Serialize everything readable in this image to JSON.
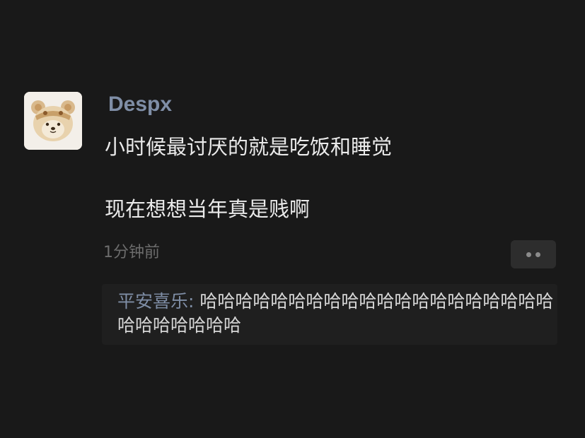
{
  "post": {
    "username": "Despx",
    "content_line1": "小时候最讨厌的就是吃饭和睡觉",
    "content_line2": "现在想想当年真是贱啊",
    "timestamp": "1分钟前",
    "avatar_icon": "bear-avatar-icon",
    "more_icon": "more-dots-icon"
  },
  "comment": {
    "author": "平安喜乐:",
    "text": " 哈哈哈哈哈哈哈哈哈哈哈哈哈哈哈哈哈哈哈哈哈哈哈哈哈哈哈"
  },
  "colors": {
    "background": "#191919",
    "username": "#7f8ea6",
    "text": "#eaeaea",
    "timestamp": "#6c6c6c"
  }
}
